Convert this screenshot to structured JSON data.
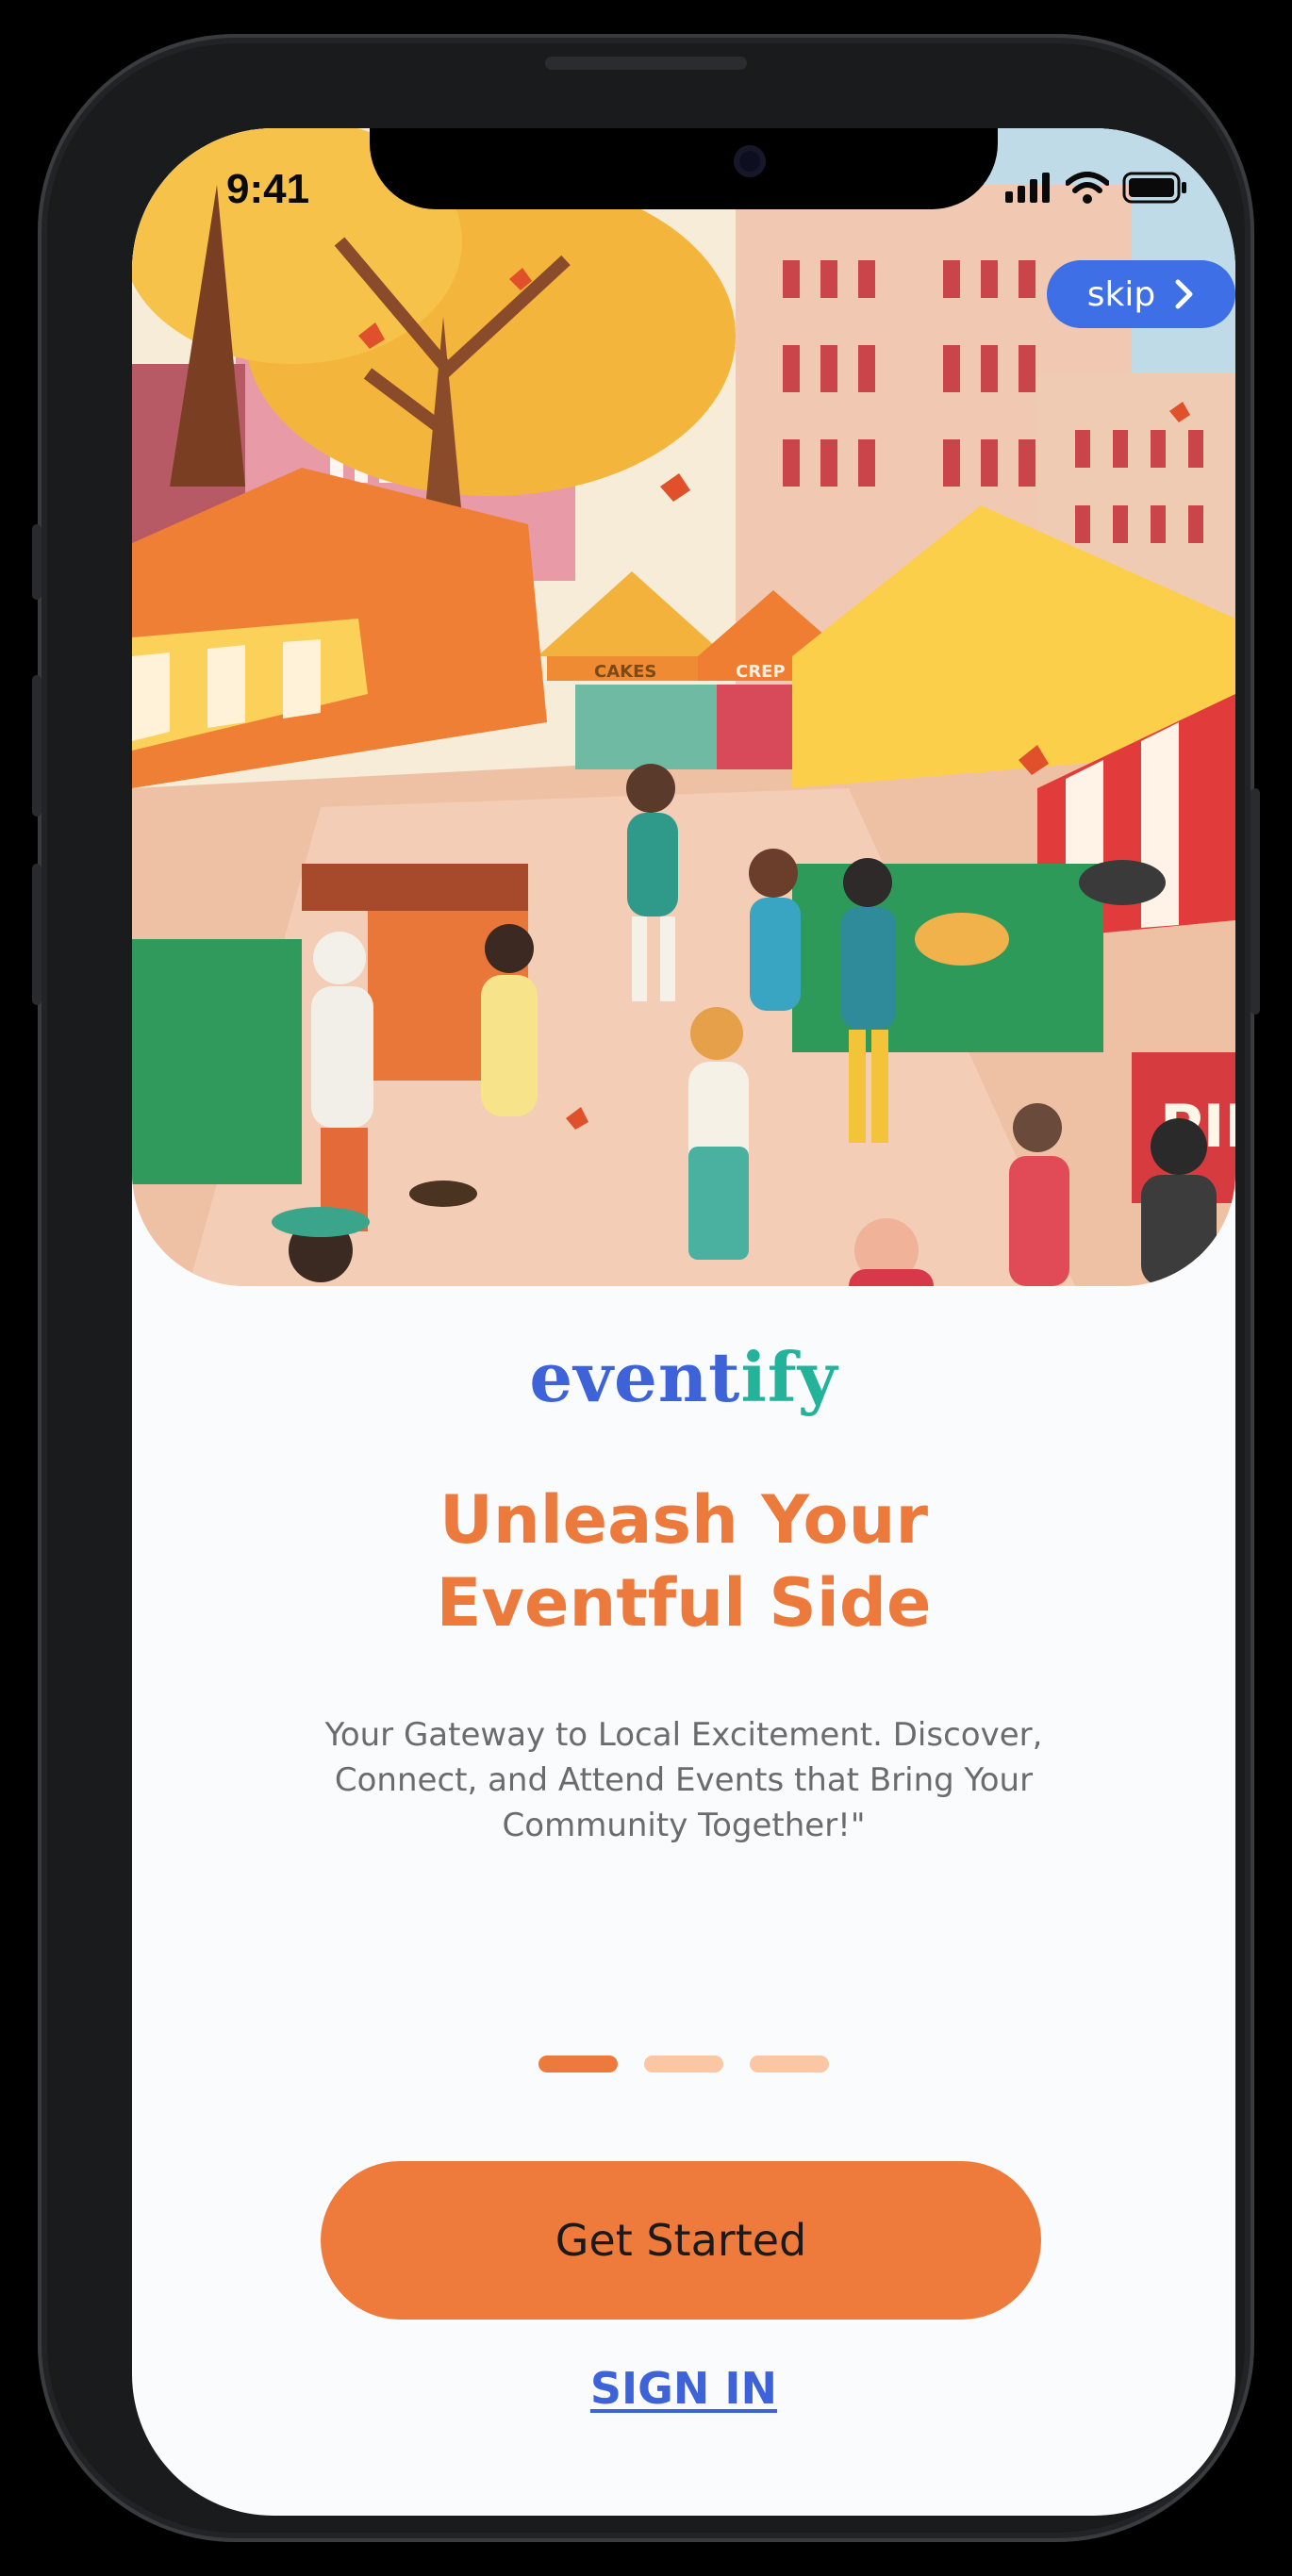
{
  "status_bar": {
    "time": "9:41",
    "icons": [
      "signal-icon",
      "wifi-icon",
      "battery-icon"
    ]
  },
  "skip": {
    "label": "skip",
    "icon": "chevron-right-icon"
  },
  "hero": {
    "stall_signs": [
      "CAKES",
      "CREP",
      "PIE"
    ]
  },
  "logo": {
    "part1": "event",
    "part2": "ify"
  },
  "headline": {
    "line1": "Unleash Your",
    "line2": "Eventful Side"
  },
  "description": "Your Gateway to Local Excitement. Discover, Connect, and Attend Events that Bring Your Community Together!\"",
  "pagination": {
    "total": 3,
    "active": 1
  },
  "buttons": {
    "primary": "Get Started",
    "secondary": "SIGN IN"
  },
  "colors": {
    "accent": "#ec7a3d",
    "brand_blue": "#3e63d9",
    "brand_teal": "#24b39a",
    "dot_inactive": "#fac6a3"
  }
}
